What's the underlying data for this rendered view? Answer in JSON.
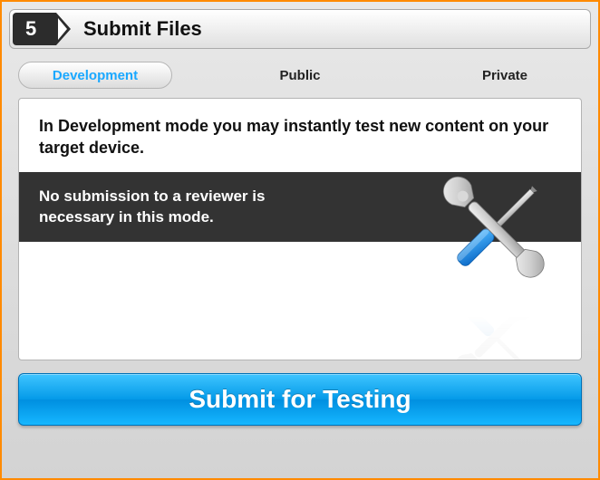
{
  "header": {
    "step_number": "5",
    "title": "Submit Files"
  },
  "tabs": {
    "development": "Development",
    "public": "Public",
    "private": "Private",
    "active": "development"
  },
  "panel": {
    "line1": "In Development mode you may instantly test new content on your target device.",
    "line2": "No submission to a reviewer is necessary in this mode."
  },
  "submit_button": "Submit for Testing"
}
